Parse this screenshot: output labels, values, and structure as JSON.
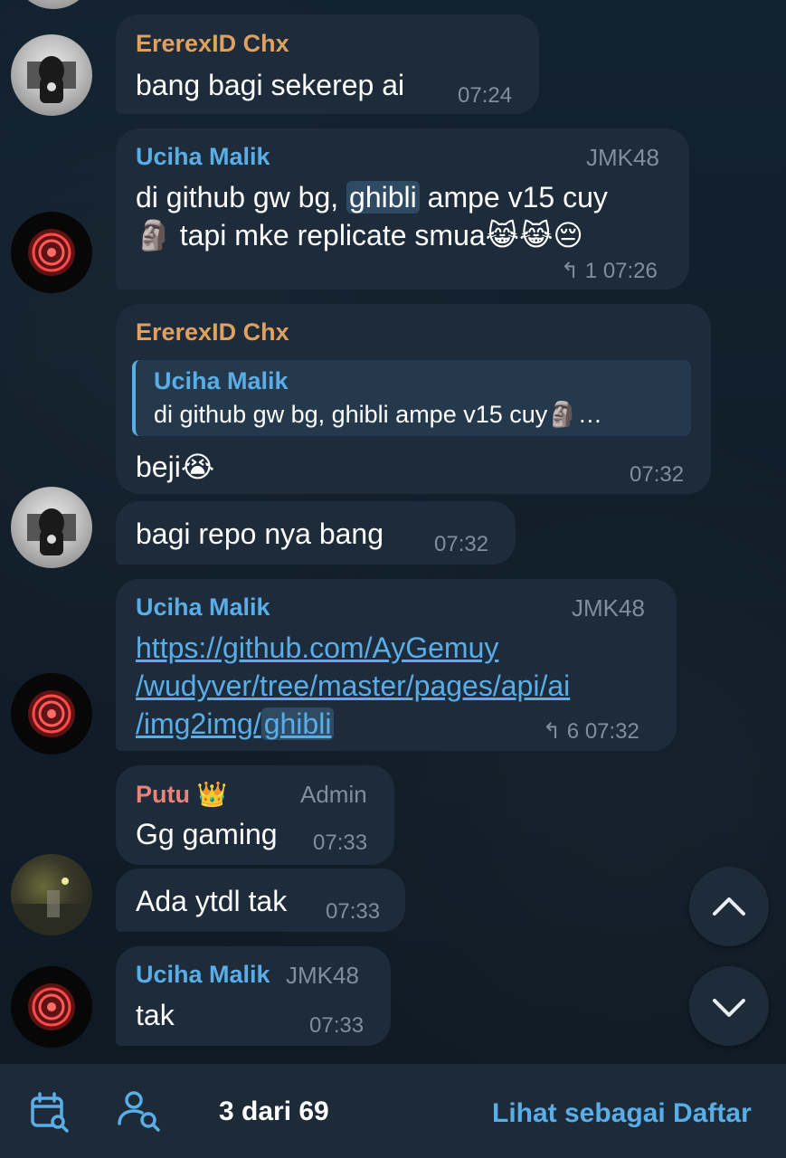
{
  "messages": [
    {
      "sender": "ErerexID Chx",
      "text": "bang bagi sekerep ai",
      "time": "07:24"
    },
    {
      "sender": "Uciha Malik",
      "tag": "JMK48",
      "line1_pre": "di github gw bg, ",
      "highlight": "ghibli",
      "line1_post": " ampe v15 cuy",
      "line2": "🗿 tapi mke replicate smua😹😹😔",
      "reply_count": "1",
      "time": "07:26"
    },
    {
      "sender": "ErerexID Chx",
      "quote_sender": "Uciha Malik",
      "quote_text": "di github gw bg, ghibli ampe v15 cuy🗿…",
      "text": "beji😭",
      "time": "07:32"
    },
    {
      "text": "bagi repo nya bang",
      "time": "07:32"
    },
    {
      "sender": "Uciha Malik",
      "tag": "JMK48",
      "link_line1": "https://github.com/AyGemuy",
      "link_line2": "/wudyver/tree/master/pages/api/ai",
      "link_line3_pre": "/img2img/",
      "link_line3_hl": "ghibli",
      "reply_count": "6",
      "time": "07:32"
    },
    {
      "sender": "Putu 👑",
      "tag": "Admin",
      "text": "Gg gaming",
      "time": "07:33"
    },
    {
      "text": "Ada ytdl tak",
      "time": "07:33"
    },
    {
      "sender": "Uciha Malik",
      "tag": "JMK48",
      "text": "tak",
      "time": "07:33"
    }
  ],
  "bottom_bar": {
    "counter": "3 dari 69",
    "view_as_list": "Lihat sebagai Daftar",
    "calendar_icon": "calendar-search-icon",
    "user_search_icon": "user-search-icon"
  },
  "fab": {
    "up_icon": "chevron-up-icon",
    "down_icon": "chevron-down-icon"
  },
  "colors": {
    "accent": "#5aaee8",
    "name_orange": "#e0a160",
    "name_pink": "#e8847a",
    "bubble": "#1d2b3a"
  }
}
